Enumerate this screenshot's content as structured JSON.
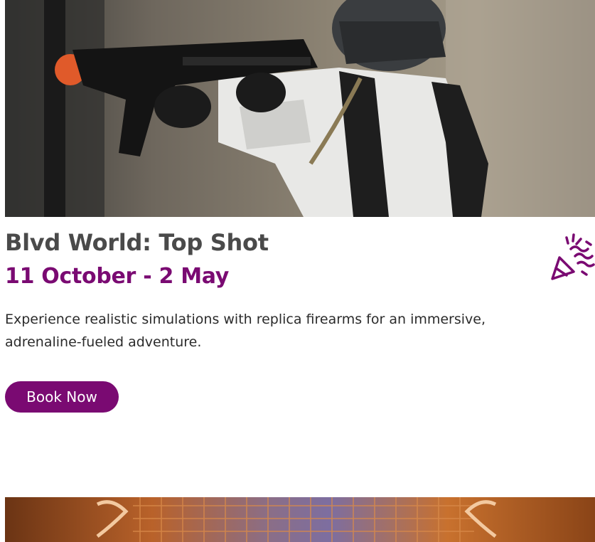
{
  "event": {
    "title": "Blvd World: Top Shot",
    "dates": "11 October - 2 May",
    "description": "Experience realistic simulations with replica firearms for an immersive, adrenaline-fueled adventure.",
    "book_label": "Book Now",
    "hero_image": "paintball-player-photo",
    "badge_icon": "party-popper-icon"
  },
  "next_event": {
    "image": "event-photo-partial"
  },
  "colors": {
    "accent": "#7a0a72",
    "title_text": "#4a4a4a",
    "body_text": "#2b2b2b"
  }
}
